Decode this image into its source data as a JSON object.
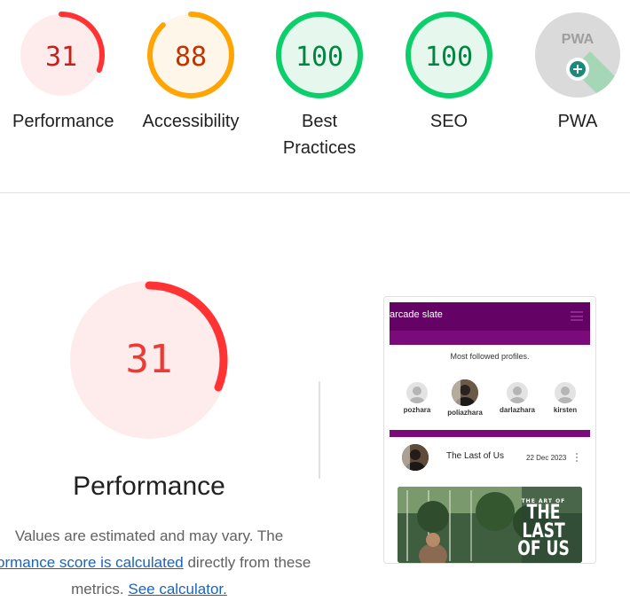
{
  "gauges": [
    {
      "id": "performance",
      "score": "31",
      "label": "Performance",
      "value": 0.31,
      "color": "#f33",
      "bg": "#fdeceb",
      "text": "#c5221f"
    },
    {
      "id": "accessibility",
      "score": "88",
      "label": "Accessibility",
      "value": 0.88,
      "color": "#ffa400",
      "bg": "#fff6ea",
      "text": "#c33300"
    },
    {
      "id": "best-practices",
      "score": "100",
      "label_line1": "Best",
      "label_line2": "Practices",
      "value": 1.0,
      "color": "#0cce6b",
      "bg": "#e6f8ee",
      "text": "#018642"
    },
    {
      "id": "seo",
      "score": "100",
      "label": "SEO",
      "value": 1.0,
      "color": "#0cce6b",
      "bg": "#e6f8ee",
      "text": "#018642"
    },
    {
      "id": "pwa",
      "badge": "PWA",
      "label": "PWA",
      "color": "#9e9e9e"
    }
  ],
  "main": {
    "score": "31",
    "value": 0.31,
    "title": "Performance",
    "desc_line1": "Values are estimated and may vary. The",
    "desc_link1": "rformance score is calculated",
    "desc_line2_rest": " directly from these",
    "desc_line3": "metrics.",
    "desc_link2": "See calculator."
  },
  "thumbnail": {
    "app_title": "arcade slate",
    "section_label": "Most followed profiles.",
    "profiles": [
      "pozhara",
      "poliazhara",
      "darlazhara",
      "kirsten"
    ],
    "post_title": "The Last of Us",
    "post_date": "22 Dec 2023",
    "poster_small": "THE ART OF",
    "poster_line1": "THE",
    "poster_line2": "LAST",
    "poster_line3": "OF US"
  }
}
